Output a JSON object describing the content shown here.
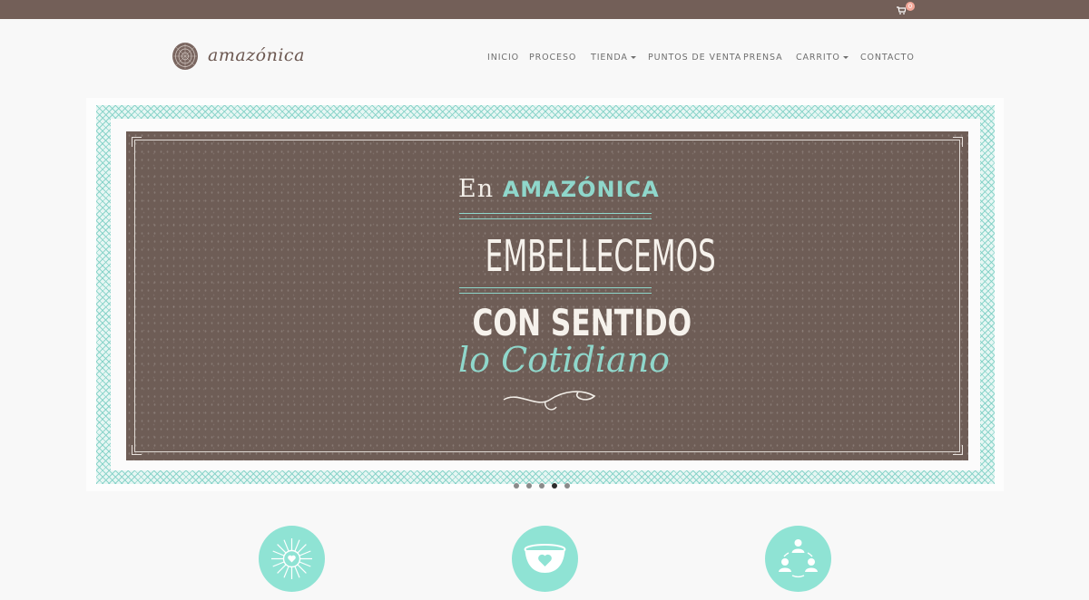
{
  "topbar": {
    "cart_count": "0",
    "icon": "cart-icon"
  },
  "brand": {
    "name": "amazónica",
    "icon": "tree-ring-logo"
  },
  "nav": {
    "items": [
      {
        "label": "INICIO",
        "dropdown": false
      },
      {
        "label": "PROCESO",
        "dropdown": false
      },
      {
        "label": "TIENDA",
        "dropdown": true
      },
      {
        "label": "PUNTOS DE VENTA",
        "dropdown": false
      },
      {
        "label": "PRENSA",
        "dropdown": false
      },
      {
        "label": "CARRITO",
        "dropdown": true
      },
      {
        "label": "CONTACTO",
        "dropdown": false
      }
    ]
  },
  "hero": {
    "line1_prefix": "En",
    "line1_brand": "AMAZÓNICA",
    "line2": "EMBELLECEMOS",
    "line3": "CON SENTIDO",
    "line4": "lo Cotidiano",
    "slides_total": 5,
    "active_slide": 4
  },
  "features": [
    {
      "icon": "sun-heart-icon"
    },
    {
      "icon": "bowl-heart-icon"
    },
    {
      "icon": "community-cycle-icon"
    }
  ],
  "colors": {
    "topbar": "#735f58",
    "accent_mint": "#8fe3d4",
    "board_brown": "#6e5d56",
    "nav_text": "#6f6f6f"
  }
}
